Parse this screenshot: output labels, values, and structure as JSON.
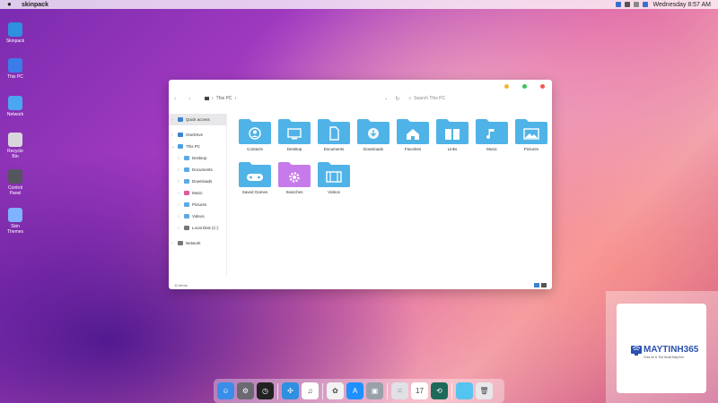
{
  "menubar": {
    "app_name": "skinpack",
    "clock": "Wednesday 8:57 AM"
  },
  "desktop_icons": [
    {
      "label": "Skinpack",
      "color": "#2f8fe0"
    },
    {
      "label": "This PC",
      "color": "#3a7de8"
    },
    {
      "label": "Network",
      "color": "#4aa6f0"
    },
    {
      "label": "Recycle Bin",
      "color": "#d8d8dc"
    },
    {
      "label": "Control Panel",
      "color": "#555560"
    },
    {
      "label": "Skin Themes",
      "color": "#7fb2ff"
    }
  ],
  "explorer": {
    "breadcrumb": [
      "This PC"
    ],
    "search_placeholder": "Search This PC",
    "sidebar": [
      {
        "label": "Quick access",
        "level": 0,
        "arrow": "›",
        "active": true,
        "color": "#3a84d0"
      },
      {
        "label": "OneDrive",
        "level": 0,
        "arrow": "›",
        "color": "#3a84d0"
      },
      {
        "label": "This PC",
        "level": 0,
        "arrow": "⌄",
        "color": "#4a9fe0"
      },
      {
        "label": "Desktop",
        "level": 1,
        "arrow": "›",
        "color": "#5aaae8"
      },
      {
        "label": "Documents",
        "level": 1,
        "arrow": "›",
        "color": "#5aaae8"
      },
      {
        "label": "Downloads",
        "level": 1,
        "arrow": "›",
        "color": "#5aaae8"
      },
      {
        "label": "Music",
        "level": 1,
        "arrow": "›",
        "color": "#e05aa0"
      },
      {
        "label": "Pictures",
        "level": 1,
        "arrow": "›",
        "color": "#5aaae8"
      },
      {
        "label": "Videos",
        "level": 1,
        "arrow": "›",
        "color": "#5aaae8"
      },
      {
        "label": "Local Disk (C:)",
        "level": 1,
        "arrow": "›",
        "color": "#777777"
      },
      {
        "label": "Network",
        "level": 0,
        "arrow": "›",
        "color": "#777777"
      }
    ],
    "folders": [
      {
        "label": "Contacts",
        "glyph": "person",
        "color": "#4fb3e8"
      },
      {
        "label": "Desktop",
        "glyph": "monitor",
        "color": "#4fb3e8"
      },
      {
        "label": "Documents",
        "glyph": "document",
        "color": "#4fb3e8"
      },
      {
        "label": "Downloads",
        "glyph": "download",
        "color": "#4fb3e8"
      },
      {
        "label": "Favorites",
        "glyph": "home",
        "color": "#4fb3e8"
      },
      {
        "label": "Links",
        "glyph": "book",
        "color": "#4fb3e8"
      },
      {
        "label": "Music",
        "glyph": "note",
        "color": "#4fb3e8"
      },
      {
        "label": "Pictures",
        "glyph": "picture",
        "color": "#4fb3e8"
      },
      {
        "label": "Saved Games",
        "glyph": "gamepad",
        "color": "#4fb3e8"
      },
      {
        "label": "Searches",
        "glyph": "gear",
        "color": "#c77bea"
      },
      {
        "label": "Videos",
        "glyph": "film",
        "color": "#4fb3e8"
      }
    ],
    "status_count": "11 items"
  },
  "watermark": {
    "brand": "MAYTINH365",
    "tagline": "Chia sẻ & Thủ thuật Máy tính"
  },
  "dock": [
    {
      "name": "finder",
      "color": "#3a8ee8",
      "glyph": "☺"
    },
    {
      "name": "settings",
      "color": "#6a6a70",
      "glyph": "⚙"
    },
    {
      "name": "clock",
      "color": "#222222",
      "glyph": "◷"
    },
    {
      "sep": true
    },
    {
      "name": "safari",
      "color": "#2f8fe0",
      "glyph": "✣"
    },
    {
      "name": "music",
      "color": "#ffffff",
      "glyph": "♫"
    },
    {
      "sep": true
    },
    {
      "name": "photos",
      "color": "#f2f2f2",
      "glyph": "✿"
    },
    {
      "name": "app-store",
      "color": "#1e90ff",
      "glyph": "A"
    },
    {
      "name": "preview",
      "color": "#9aa0a8",
      "glyph": "▣"
    },
    {
      "sep": true
    },
    {
      "name": "launchpad",
      "color": "#e0e0e6",
      "glyph": "⁙"
    },
    {
      "name": "calendar",
      "color": "#ffffff",
      "glyph": "17"
    },
    {
      "name": "time-machine",
      "color": "#1d6a5a",
      "glyph": "⟲"
    },
    {
      "sep": true
    },
    {
      "name": "downloads-folder",
      "color": "#56c4f0",
      "glyph": ""
    },
    {
      "name": "trash",
      "color": "#e8e8ec",
      "glyph": "🗑"
    }
  ]
}
